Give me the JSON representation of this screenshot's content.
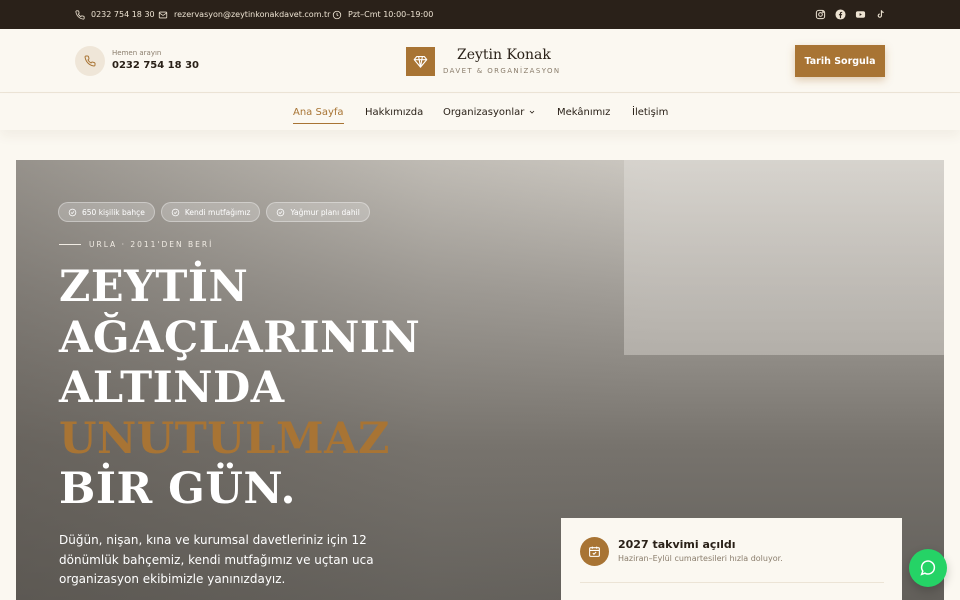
{
  "topbar": {
    "phone": "0232 754 18 30",
    "email": "rezervasyon@zeytinkonakdavet.com.tr",
    "hours": "Pzt–Cmt 10:00–19:00",
    "social": [
      "instagram-icon",
      "facebook-icon",
      "youtube-icon",
      "tiktok-icon"
    ]
  },
  "header": {
    "call_label": "Hemen arayın",
    "call_number": "0232 754 18 30",
    "brand_name": "Zeytin Konak",
    "brand_sub": "DAVET & ORGANİZASYON",
    "cta": "Tarih Sorgula"
  },
  "nav": {
    "items": [
      "Ana Sayfa",
      "Hakkımızda",
      "Organizasyonlar",
      "Mekânımız",
      "İletişim"
    ],
    "active": "Ana Sayfa"
  },
  "hero": {
    "badges": [
      "650 kişilik bahçe",
      "Kendi mutfağımız",
      "Yağmur planı dahil"
    ],
    "eyebrow": "URLA · 2011'DEN BERİ",
    "headline": {
      "line1": "ZEYTİN",
      "line2": "AĞAÇLARININ",
      "line3": "ALTINDA",
      "accent": "UNUTULMAZ",
      "line5": "BİR GÜN."
    },
    "description": "Düğün, nişan, kına ve kurumsal davetleriniz için 12 dönümlük bahçemiz, kendi mutfağımız ve uçtan uca organizasyon ekibimizle yanınızdayız."
  },
  "card": {
    "title": "2027 takvimi açıldı",
    "subtitle": "Haziran–Eylül cumartesileri hızla doluyor."
  },
  "colors": {
    "accent": "#a87434",
    "topbar": "#2a2119",
    "background": "#fbf8f1",
    "whatsapp": "#25d366"
  }
}
